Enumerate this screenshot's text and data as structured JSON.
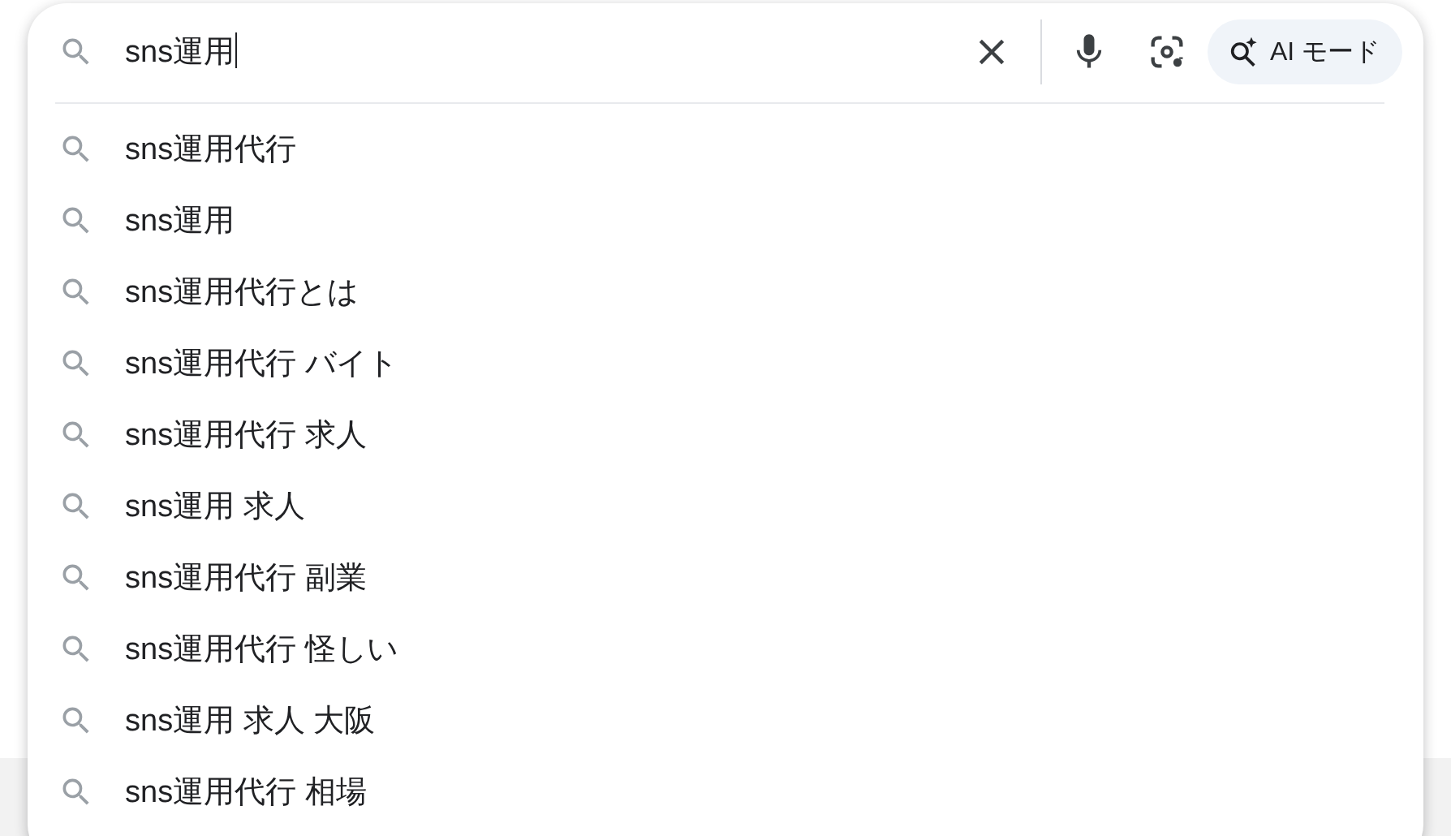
{
  "search": {
    "value": "sns運用",
    "ai_mode_label": "AI モード"
  },
  "suggestions": [
    {
      "text": "sns運用代行"
    },
    {
      "text": "sns運用"
    },
    {
      "text": "sns運用代行とは"
    },
    {
      "text": "sns運用代行 バイト"
    },
    {
      "text": "sns運用代行 求人"
    },
    {
      "text": "sns運用 求人"
    },
    {
      "text": "sns運用代行 副業"
    },
    {
      "text": "sns運用代行 怪しい"
    },
    {
      "text": "sns運用 求人 大阪"
    },
    {
      "text": "sns運用代行 相場"
    }
  ]
}
